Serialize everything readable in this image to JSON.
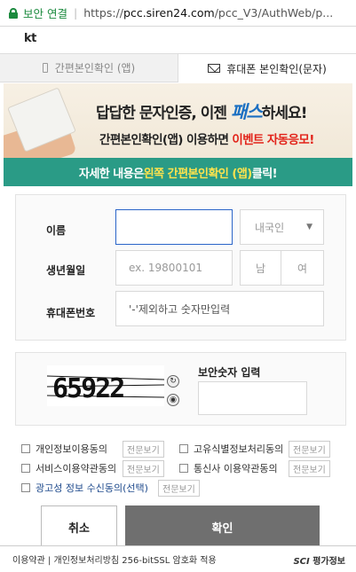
{
  "browser": {
    "security_label": "보안 연결",
    "url_prefix": "https://",
    "url_host": "pcc.siren24.com",
    "url_path": "/pcc_V3/AuthWeb/p..."
  },
  "brand": {
    "logo": "kt"
  },
  "tabs": [
    {
      "label": "간편본인확인 (앱)"
    },
    {
      "label": "휴대폰 본인확인(문자)"
    }
  ],
  "banner": {
    "line1_prefix": "답답한 문자인증, 이젠 ",
    "line1_highlight": "패스",
    "line1_suffix": "하세요!",
    "line2_prefix": "간편본인확인(앱) 이용하면 ",
    "line2_highlight": "이벤트 자동응모!",
    "line3_prefix": "자세한 내용은 ",
    "line3_highlight": "왼쪽 간편본인확인 (앱)",
    "line3_suffix": " 클릭!"
  },
  "form": {
    "name_label": "이름",
    "nationality_value": "내국인",
    "birth_label": "생년월일",
    "birth_placeholder": "ex. 19800101",
    "gender_male": "남",
    "gender_female": "여",
    "phone_label": "휴대폰번호",
    "phone_placeholder": "'-'제외하고 숫자만입력"
  },
  "captcha": {
    "code": "65922",
    "label": "보안숫자 입력"
  },
  "agreements": [
    {
      "label": "개인정보이용동의",
      "view": "전문보기"
    },
    {
      "label": "고유식별정보처리동의",
      "view": "전문보기"
    },
    {
      "label": "서비스이용약관동의",
      "view": "전문보기"
    },
    {
      "label": "통신사 이용약관동의",
      "view": "전문보기"
    },
    {
      "label": "광고성 정보 수신동의(선택)",
      "view": "전문보기"
    }
  ],
  "buttons": {
    "cancel": "취소",
    "confirm": "확인"
  },
  "footer": {
    "text": "이용약관 | 개인정보처리방침 256-bitSSL 암호화 적용",
    "sci": "SCI",
    "sci_suffix": "평가정보"
  }
}
